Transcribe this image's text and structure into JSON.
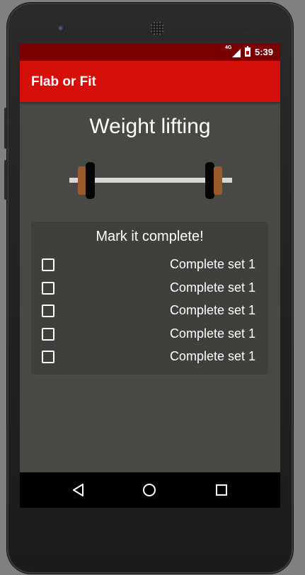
{
  "status_bar": {
    "network_label": "4G",
    "time": "5:39",
    "icons": [
      "signal-icon",
      "battery-icon"
    ]
  },
  "app_bar": {
    "title": "Flab or Fit"
  },
  "main": {
    "heading": "Weight lifting",
    "image": "barbell-icon"
  },
  "card": {
    "title": "Mark it complete!",
    "items": [
      {
        "label": "Complete set 1",
        "checked": false
      },
      {
        "label": "Complete set 1",
        "checked": false
      },
      {
        "label": "Complete set 1",
        "checked": false
      },
      {
        "label": "Complete set 1",
        "checked": false
      },
      {
        "label": "Complete set 1",
        "checked": false
      }
    ]
  },
  "nav_bar": {
    "icons": [
      "back-icon",
      "home-icon",
      "recents-icon"
    ]
  },
  "colors": {
    "status_bar": "#7a0000",
    "app_bar": "#d50f0a",
    "background": "#484845",
    "card": "#3f3f3c",
    "plate": "#9a5a2c"
  }
}
